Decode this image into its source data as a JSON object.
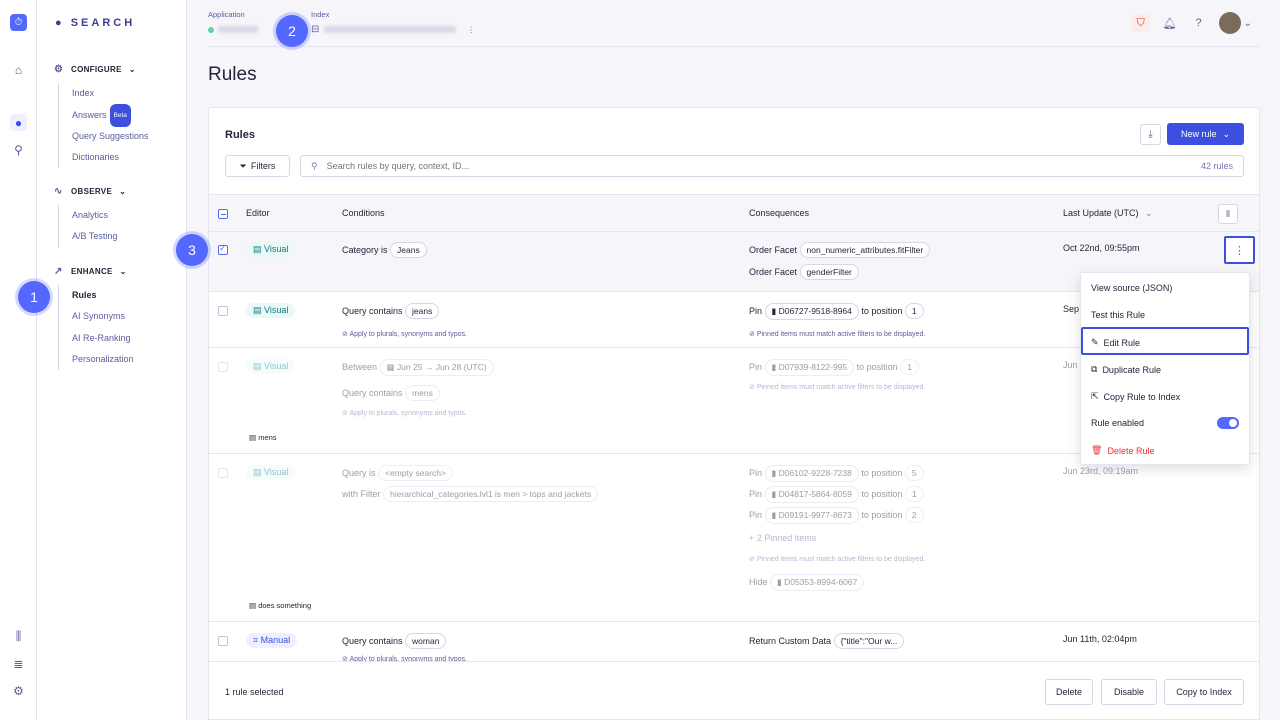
{
  "app": {
    "logo": "SEARCH"
  },
  "sidebar": {
    "sections": [
      {
        "label": "CONFIGURE",
        "items": [
          {
            "label": "Index"
          },
          {
            "label": "Answers",
            "badge": "Beta"
          },
          {
            "label": "Query Suggestions"
          },
          {
            "label": "Dictionaries"
          }
        ]
      },
      {
        "label": "OBSERVE",
        "items": [
          {
            "label": "Analytics"
          },
          {
            "label": "A/B Testing"
          }
        ]
      },
      {
        "label": "ENHANCE",
        "items": [
          {
            "label": "Rules",
            "active": true
          },
          {
            "label": "AI Synonyms"
          },
          {
            "label": "AI Re-Ranking"
          },
          {
            "label": "Personalization"
          }
        ]
      }
    ]
  },
  "markers": [
    "1",
    "2",
    "3"
  ],
  "header": {
    "application_label": "Application",
    "index_label": "Index"
  },
  "page": {
    "title": "Rules"
  },
  "card": {
    "title": "Rules",
    "new_rule": "New rule",
    "filters": "Filters",
    "search_placeholder": "Search rules by query, context, ID...",
    "count": "42 rules"
  },
  "table": {
    "headers": {
      "editor": "Editor",
      "conditions": "Conditions",
      "consequences": "Consequences",
      "last_update": "Last Update (UTC)"
    },
    "rows": [
      {
        "editor": "Visual",
        "cond": [
          [
            "Category is",
            "Jeans"
          ]
        ],
        "cons": [
          [
            "Order Facet",
            "non_numeric_attributes.fitFilter"
          ],
          [
            "Order Facet",
            "genderFilter"
          ]
        ],
        "date": "Oct 22nd, 09:55pm"
      },
      {
        "editor": "Visual",
        "cond": [
          [
            "Query contains",
            "jeans"
          ]
        ],
        "cond_note": "Apply to plurals, synonyms and typos.",
        "cons": [
          [
            "Pin",
            "D06727-9518-8964",
            "to position",
            "1"
          ]
        ],
        "cons_note": "Pinned items must match active filters to be displayed.",
        "date": "Sep"
      },
      {
        "editor": "Visual",
        "between": "Between",
        "range": "Jun 25 → Jun 28 (UTC)",
        "cond": [
          [
            "Query contains",
            "mens"
          ]
        ],
        "cond_note": "Apply to plurals, synonyms and typos.",
        "cons": [
          [
            "Pin",
            "D07939-8122-995",
            "to position",
            "1"
          ]
        ],
        "cons_note": "Pinned items must match active filters to be displayed.",
        "desc": "mens",
        "date": "Jun"
      },
      {
        "editor": "Visual",
        "cond": [
          [
            "Query is",
            "<empty search>"
          ],
          [
            "with Filter",
            "hierarchical_categories.lvl1 is men > tops and jackets"
          ]
        ],
        "cons": [
          [
            "Pin",
            "D06102-9228-7238",
            "to position",
            "5"
          ],
          [
            "Pin",
            "D04817-5864-8059",
            "to position",
            "1"
          ],
          [
            "Pin",
            "D09191-9977-8673",
            "to position",
            "2"
          ]
        ],
        "more": "+ 2 Pinned items",
        "cons_note": "Pinned items must match active filters to be displayed.",
        "hide": [
          "Hide",
          "D05353-8994-6067"
        ],
        "desc": "does something",
        "date": "Jun 23rd, 09:19am"
      },
      {
        "editor": "Manual",
        "cond": [
          [
            "Query contains",
            "woman"
          ]
        ],
        "cond_note": "Apply to plurals, synonyms and typos.",
        "cons": [
          [
            "Return Custom Data",
            "{\"title\":\"Our w..."
          ]
        ],
        "date": "Jun 11th, 02:04pm"
      }
    ]
  },
  "menu": {
    "items": [
      "View source (JSON)",
      "Test this Rule",
      "Edit Rule",
      "Duplicate Rule",
      "Copy Rule to Index",
      "Rule enabled",
      "Delete Rule"
    ],
    "rule_enabled": true
  },
  "footer": {
    "selected": "1 rule selected",
    "delete": "Delete",
    "disable": "Disable",
    "copy": "Copy to Index"
  },
  "colors": {
    "accent": "#3c4fe0",
    "marker": "#5468ff",
    "danger": "#e8312d"
  }
}
